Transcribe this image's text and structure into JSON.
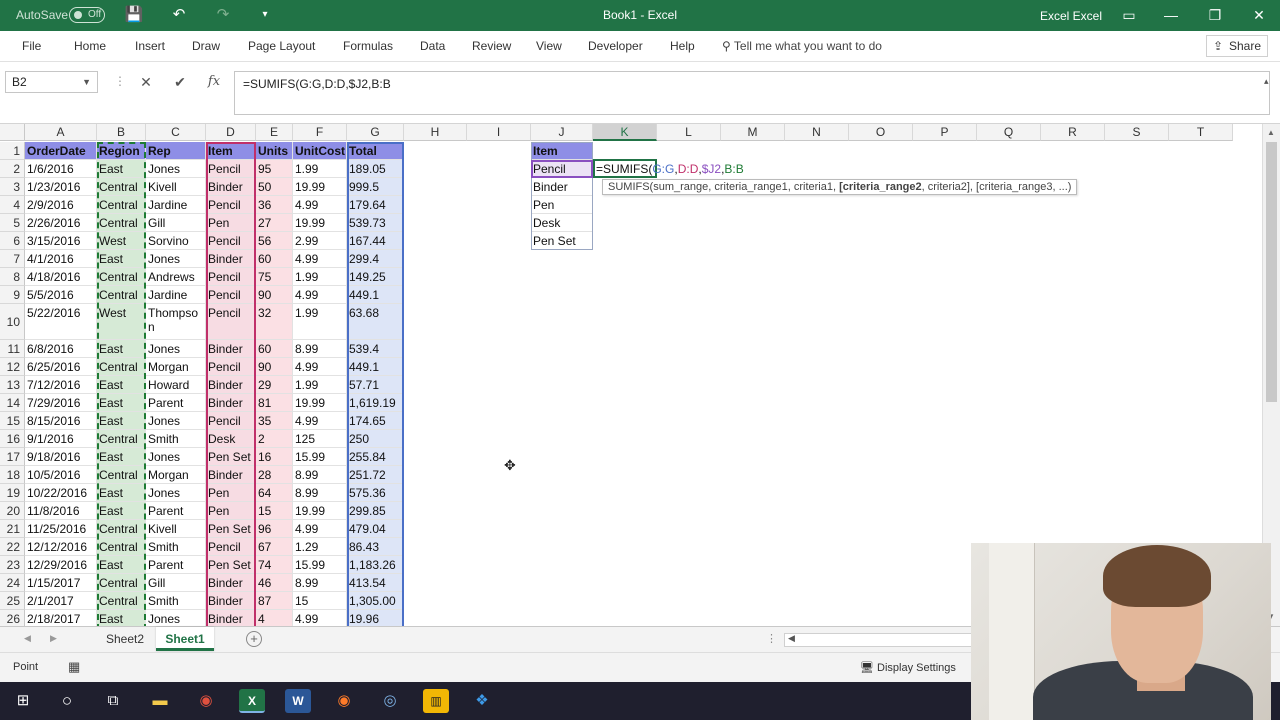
{
  "titlebar": {
    "autosave_label": "AutoSave",
    "autosave_state": "Off",
    "doc_title": "Book1 - Excel",
    "user": "Excel Excel"
  },
  "ribbon": {
    "tabs": [
      "File",
      "Home",
      "Insert",
      "Draw",
      "Page Layout",
      "Formulas",
      "Data",
      "Review",
      "View",
      "Developer",
      "Help"
    ],
    "tell_me": "Tell me what you want to do",
    "share": "Share"
  },
  "formula_bar": {
    "name_box": "B2",
    "formula": "=SUMIFS(G:G,D:D,$J2,B:B"
  },
  "columns": [
    "A",
    "B",
    "C",
    "D",
    "E",
    "F",
    "G",
    "H",
    "I",
    "J",
    "K",
    "L",
    "M",
    "N",
    "O",
    "P",
    "Q",
    "R",
    "S",
    "T"
  ],
  "rows": [
    "1",
    "2",
    "3",
    "4",
    "5",
    "6",
    "7",
    "8",
    "9",
    "10",
    "11",
    "12",
    "13",
    "14",
    "15",
    "16",
    "17",
    "18",
    "19",
    "20",
    "21",
    "22",
    "23",
    "24",
    "25",
    "26"
  ],
  "headers": [
    "OrderDate",
    "Region",
    "Rep",
    "Item",
    "Units",
    "UnitCost",
    "Total"
  ],
  "data": [
    [
      "1/6/2016",
      "East",
      "Jones",
      "Pencil",
      "95",
      "1.99",
      "189.05"
    ],
    [
      "1/23/2016",
      "Central",
      "Kivell",
      "Binder",
      "50",
      "19.99",
      "999.5"
    ],
    [
      "2/9/2016",
      "Central",
      "Jardine",
      "Pencil",
      "36",
      "4.99",
      "179.64"
    ],
    [
      "2/26/2016",
      "Central",
      "Gill",
      "Pen",
      "27",
      "19.99",
      "539.73"
    ],
    [
      "3/15/2016",
      "West",
      "Sorvino",
      "Pencil",
      "56",
      "2.99",
      "167.44"
    ],
    [
      "4/1/2016",
      "East",
      "Jones",
      "Binder",
      "60",
      "4.99",
      "299.4"
    ],
    [
      "4/18/2016",
      "Central",
      "Andrews",
      "Pencil",
      "75",
      "1.99",
      "149.25"
    ],
    [
      "5/5/2016",
      "Central",
      "Jardine",
      "Pencil",
      "90",
      "4.99",
      "449.1"
    ],
    [
      "5/22/2016",
      "West",
      "Thompson",
      "Pencil",
      "32",
      "1.99",
      "63.68"
    ],
    [
      "6/8/2016",
      "East",
      "Jones",
      "Binder",
      "60",
      "8.99",
      "539.4"
    ],
    [
      "6/25/2016",
      "Central",
      "Morgan",
      "Pencil",
      "90",
      "4.99",
      "449.1"
    ],
    [
      "7/12/2016",
      "East",
      "Howard",
      "Binder",
      "29",
      "1.99",
      "57.71"
    ],
    [
      "7/29/2016",
      "East",
      "Parent",
      "Binder",
      "81",
      "19.99",
      "1,619.19"
    ],
    [
      "8/15/2016",
      "East",
      "Jones",
      "Pencil",
      "35",
      "4.99",
      "174.65"
    ],
    [
      "9/1/2016",
      "Central",
      "Smith",
      "Desk",
      "2",
      "125",
      "250"
    ],
    [
      "9/18/2016",
      "East",
      "Jones",
      "Pen Set",
      "16",
      "15.99",
      "255.84"
    ],
    [
      "10/5/2016",
      "Central",
      "Morgan",
      "Binder",
      "28",
      "8.99",
      "251.72"
    ],
    [
      "10/22/2016",
      "East",
      "Jones",
      "Pen",
      "64",
      "8.99",
      "575.36"
    ],
    [
      "11/8/2016",
      "East",
      "Parent",
      "Pen",
      "15",
      "19.99",
      "299.85"
    ],
    [
      "11/25/2016",
      "Central",
      "Kivell",
      "Pen Set",
      "96",
      "4.99",
      "479.04"
    ],
    [
      "12/12/2016",
      "Central",
      "Smith",
      "Pencil",
      "67",
      "1.29",
      "86.43"
    ],
    [
      "12/29/2016",
      "East",
      "Parent",
      "Pen Set",
      "74",
      "15.99",
      "1,183.26"
    ],
    [
      "1/15/2017",
      "Central",
      "Gill",
      "Binder",
      "46",
      "8.99",
      "413.54"
    ],
    [
      "2/1/2017",
      "Central",
      "Smith",
      "Binder",
      "87",
      "15",
      "1,305.00"
    ],
    [
      "2/18/2017",
      "East",
      "Jones",
      "Binder",
      "4",
      "4.99",
      "19.96"
    ]
  ],
  "lookup": {
    "header": "Item",
    "items": [
      "Pencil",
      "Binder",
      "Pen",
      "Desk",
      "Pen Set"
    ]
  },
  "editing": {
    "p1": "=SUMIFS(",
    "p2": "G:G",
    "p3": ",",
    "p4": "D:D",
    "p5": ",",
    "p6": "$J2",
    "p7": ",",
    "p8": "B:B"
  },
  "tooltip": {
    "pre": "SUMIFS(sum_range, criteria_range1, criteria1, ",
    "bold": "[criteria_range2",
    "post": ", criteria2], [criteria_range3, ...)"
  },
  "sheets": [
    "Sheet2",
    "Sheet1"
  ],
  "status": {
    "mode": "Point",
    "display_settings": "Display Settings"
  },
  "colors": {
    "excel_green": "#217346",
    "header_fill": "#8e8ee6",
    "region_fill": "#d6ead6",
    "item_fill": "#f7dce3",
    "units_fill": "#fbe0e4",
    "total_fill": "#dde5f7",
    "lookup_fill": "#ece2f5"
  }
}
